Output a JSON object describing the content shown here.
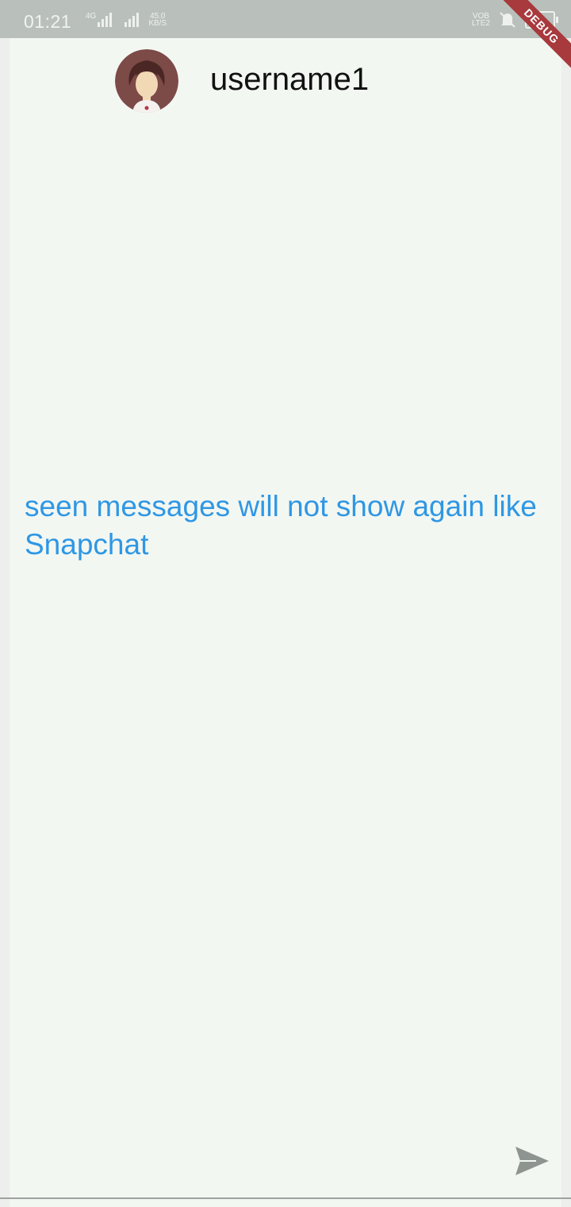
{
  "status_bar": {
    "time": "01:21",
    "network_speed": "45.0",
    "network_speed_unit": "KB/S",
    "network_type": "4G",
    "volte": "VOB",
    "volte_sub": "LTE2"
  },
  "debug_banner": {
    "label": "DEBUG"
  },
  "header": {
    "username": "username1",
    "avatar_icon": "user-avatar-icon"
  },
  "chat": {
    "message": "seen messages will not show again like Snapchat"
  },
  "composer": {
    "send_icon": "send-icon"
  },
  "colors": {
    "message_text": "#2f97e4",
    "debug_ribbon": "#a8393d",
    "status_bar": "#b9c0bb",
    "background": "#f3f7f2"
  }
}
